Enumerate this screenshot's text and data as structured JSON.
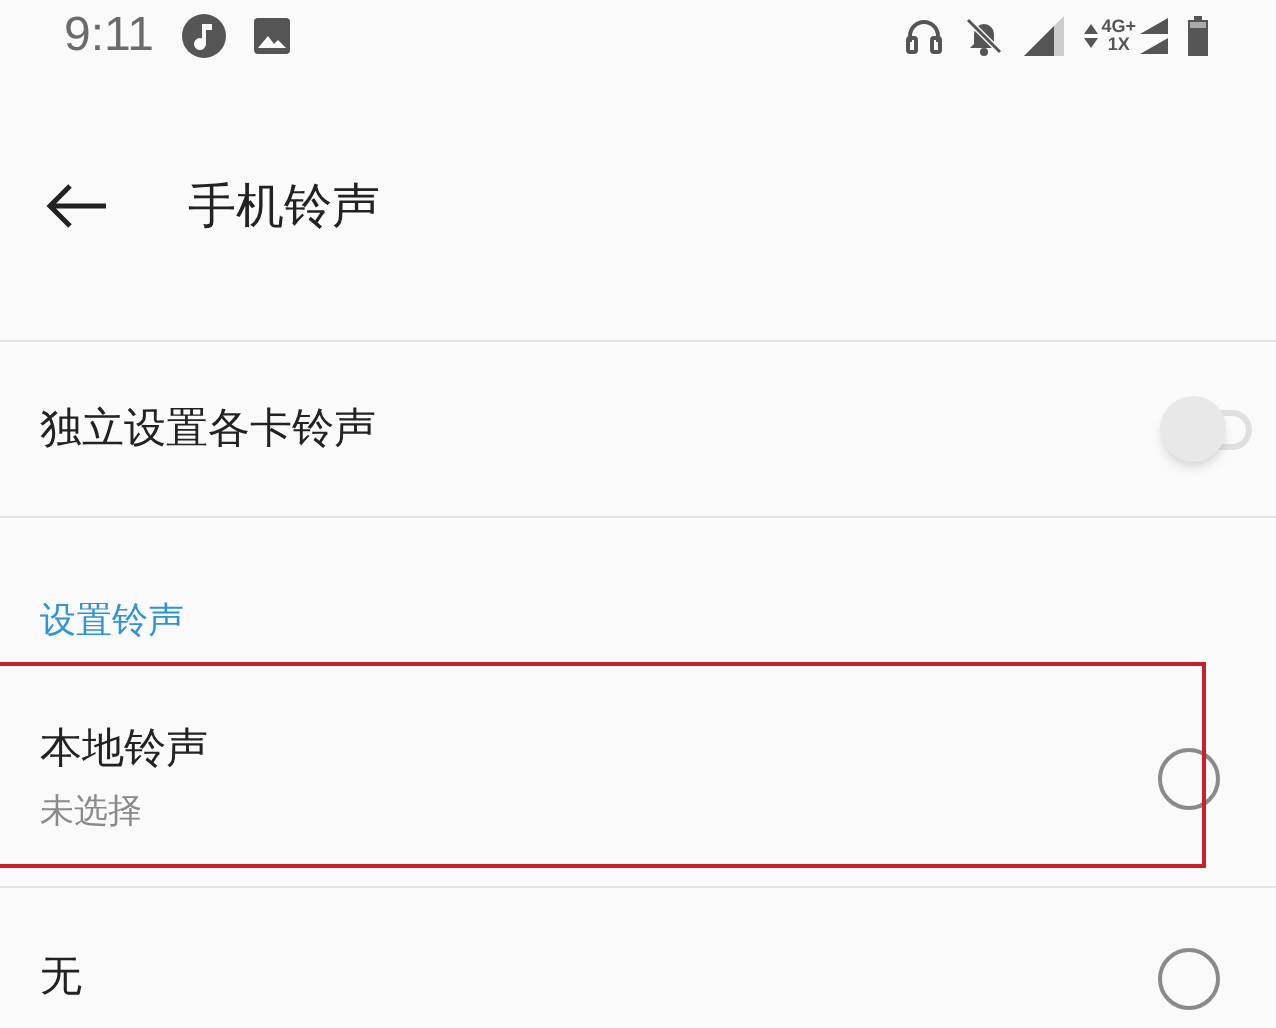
{
  "status_bar": {
    "time": "9:11",
    "network_top": "4G+",
    "network_bottom": "1X"
  },
  "header": {
    "title": "手机铃声"
  },
  "switch_row": {
    "label": "独立设置各卡铃声",
    "on": false
  },
  "section": {
    "title": "设置铃声"
  },
  "options": [
    {
      "label": "本地铃声",
      "subtitle": "未选择",
      "selected": false,
      "highlighted": true
    },
    {
      "label": "无",
      "selected": false,
      "highlighted": false
    }
  ]
}
